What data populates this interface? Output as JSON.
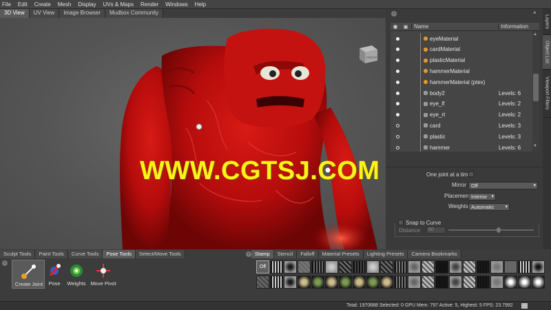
{
  "menu": [
    "File",
    "Edit",
    "Create",
    "Mesh",
    "Display",
    "UVs & Maps",
    "Render",
    "Windows",
    "Help"
  ],
  "view_tabs": [
    "3D View",
    "UV View",
    "Image Browser",
    "Mudbox Community"
  ],
  "viewcube_label": "FRONT",
  "watermark": "WWW.CGTSJ.COM",
  "side_tabs": [
    "Layers",
    "Object List",
    "Viewport Filters"
  ],
  "object_list": {
    "col_name": "Name",
    "col_info": "Information",
    "rows": [
      {
        "name": "eyeMaterial",
        "info": "",
        "icon": "material-icon",
        "dot": "filled"
      },
      {
        "name": "cardMaterial",
        "info": "",
        "icon": "material-icon",
        "dot": "filled"
      },
      {
        "name": "plasticMaterial",
        "info": "",
        "icon": "material-icon",
        "dot": "filled"
      },
      {
        "name": "hammerMaterial",
        "info": "",
        "icon": "material-icon",
        "dot": "filled"
      },
      {
        "name": "hammerMaterial (ptex)",
        "info": "",
        "icon": "material-icon",
        "dot": "filled"
      },
      {
        "name": "body2",
        "info": "Levels: 6",
        "icon": "mesh-icon",
        "dot": "filled"
      },
      {
        "name": "eye_lf",
        "info": "Levels: 2",
        "icon": "mesh-icon",
        "dot": "filled"
      },
      {
        "name": "eye_rt",
        "info": "Levels: 2",
        "icon": "mesh-icon",
        "dot": "filled"
      },
      {
        "name": "card",
        "info": "Levels: 3",
        "icon": "mesh-icon",
        "dot": "hollow"
      },
      {
        "name": "plastic",
        "info": "Levels: 3",
        "icon": "mesh-icon",
        "dot": "hollow"
      },
      {
        "name": "hammer",
        "info": "Levels: 6",
        "icon": "mesh-icon",
        "dot": "hollow"
      }
    ]
  },
  "properties": {
    "one_joint_label": "One joint at a time",
    "mirror_label": "Mirror",
    "mirror_value": "Off",
    "placement_label": "Placement",
    "placement_value": "Interior",
    "weights_label": "Weights",
    "weights_value": "Automatic",
    "snap_label": "Snap to Curve",
    "distance_label": "Distance",
    "distance_value": "60"
  },
  "tool_tabs": [
    "Sculpt Tools",
    "Paint Tools",
    "Curve Tools",
    "Pose Tools",
    "Select/Move Tools"
  ],
  "pose_tools": [
    "Create Joint",
    "Pose",
    "Weights",
    "Move Pivot"
  ],
  "stamp_tabs": [
    "Stamp",
    "Stencil",
    "Falloff",
    "Material Presets",
    "Lighting Presets",
    "Camera Bookmarks"
  ],
  "stamp_off_label": "Off",
  "status_text": "Total: 1970688  Selected: 0  GPU Mem: 797  Active: 5, Highest: 5  FPS: 23.7992",
  "colors": {
    "accent_orange": "#e89a2a",
    "creature_red": "#c81010",
    "watermark_yellow": "#fff21a"
  }
}
